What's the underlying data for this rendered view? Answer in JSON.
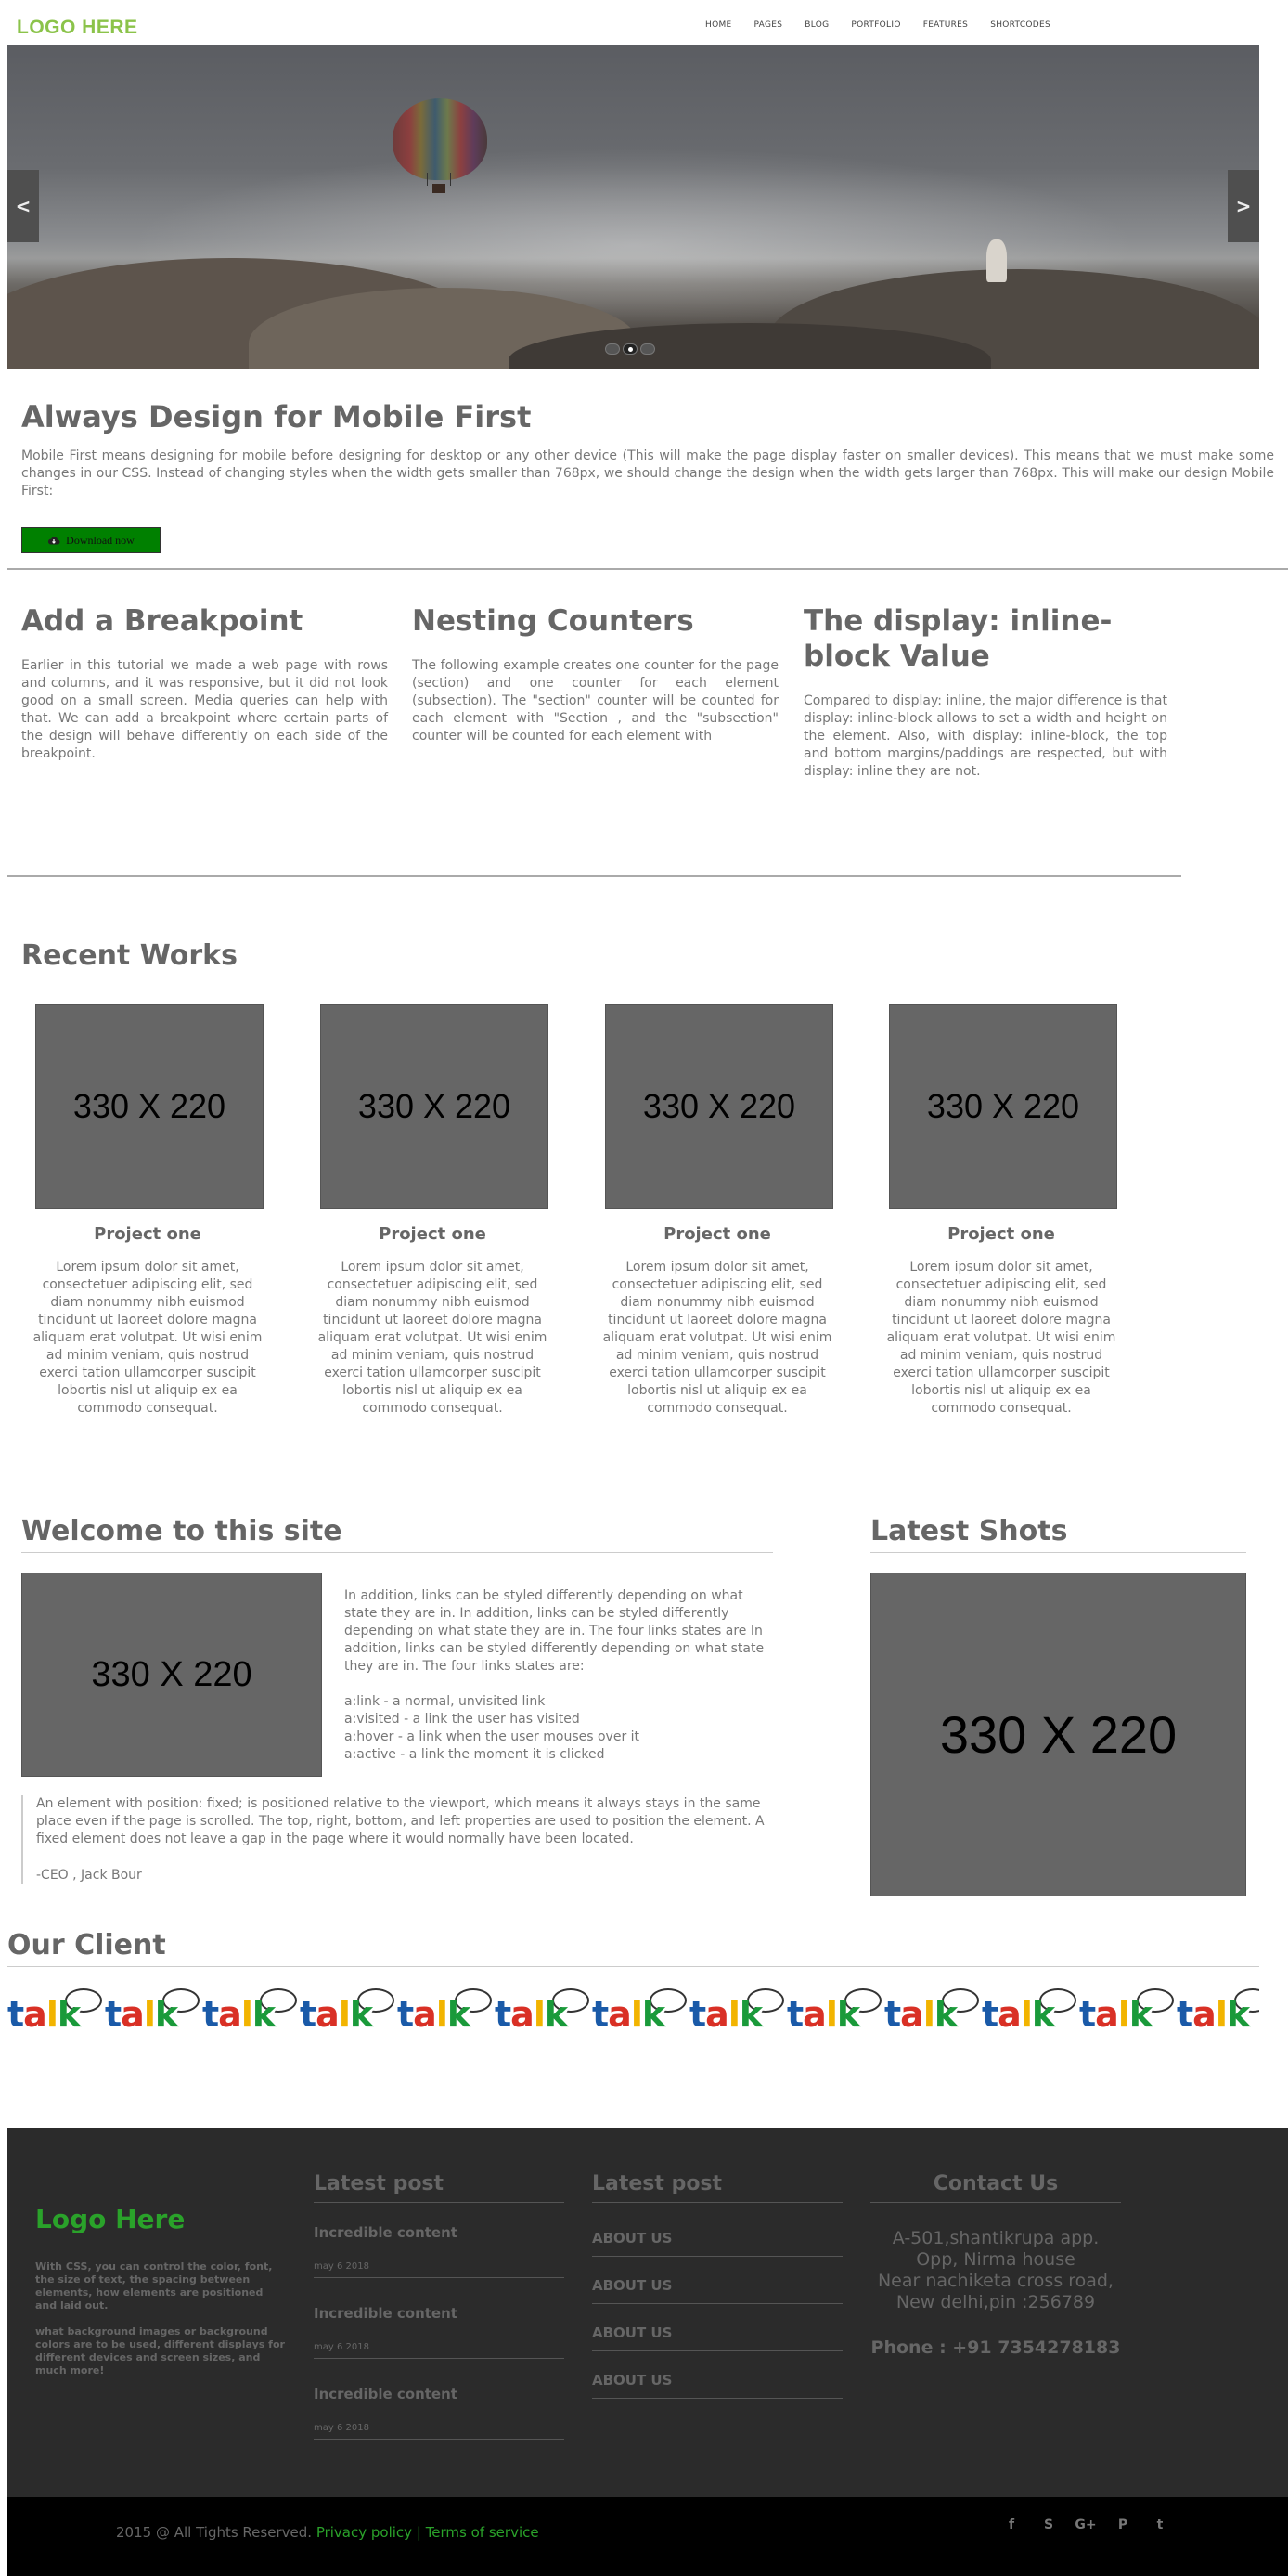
{
  "header": {
    "logo": "LOGO HERE",
    "nav": [
      "HOME",
      "PAGES",
      "BLOG",
      "PORTFOLIO",
      "FEATURES",
      "SHORTCODES"
    ]
  },
  "slider": {
    "prev_label": "<",
    "next_label": ">",
    "slide_count": 3,
    "active_slide": 2
  },
  "intro": {
    "title": "Always Design for Mobile First",
    "text": "Mobile First means designing for mobile before designing for desktop or any other device (This will make the page display faster on smaller devices). This means that we must make some changes in our CSS. Instead of changing styles when the width gets smaller than 768px, we should change the design when the width gets larger than 768px. This will make our design Mobile First:",
    "button_label": "Download now",
    "button_icon": "cloud-download-icon"
  },
  "features": [
    {
      "title": "Add a Breakpoint",
      "text": "Earlier in this tutorial we made a web page with rows and columns, and it was responsive, but it did not look good on a small screen. Media queries can help with that. We can add a breakpoint where certain parts of the design will behave differently on each side of the breakpoint."
    },
    {
      "title": "Nesting Counters",
      "text": "The following example creates one counter for the page (section) and one counter for each element (subsection). The \"section\" counter will be counted for each element with \"Section , and the \"subsection\" counter will be counted for each element with"
    },
    {
      "title": "The display: inline-block Value",
      "text": "Compared to display: inline, the major difference is that display: inline-block allows to set a width and height on the element. Also, with display: inline-block, the top and bottom margins/paddings are respected, but with display: inline they are not."
    }
  ],
  "recent_works": {
    "title": "Recent Works",
    "items": [
      {
        "image_label": "330 X  220",
        "title": "Project one",
        "text": "Lorem ipsum dolor sit amet, consectetuer adipiscing elit, sed diam nonummy nibh euismod tincidunt ut laoreet dolore magna aliquam erat volutpat. Ut wisi enim ad minim veniam, quis nostrud exerci tation ullamcorper suscipit lobortis nisl ut aliquip ex ea commodo consequat."
      },
      {
        "image_label": "330 X  220",
        "title": "Project one",
        "text": "Lorem ipsum dolor sit amet, consectetuer adipiscing elit, sed diam nonummy nibh euismod tincidunt ut laoreet dolore magna aliquam erat volutpat. Ut wisi enim ad minim veniam, quis nostrud exerci tation ullamcorper suscipit lobortis nisl ut aliquip ex ea commodo consequat."
      },
      {
        "image_label": "330 X  220",
        "title": "Project one",
        "text": "Lorem ipsum dolor sit amet, consectetuer adipiscing elit, sed diam nonummy nibh euismod tincidunt ut laoreet dolore magna aliquam erat volutpat. Ut wisi enim ad minim veniam, quis nostrud exerci tation ullamcorper suscipit lobortis nisl ut aliquip ex ea commodo consequat."
      },
      {
        "image_label": "330 X  220",
        "title": "Project one",
        "text": "Lorem ipsum dolor sit amet, consectetuer adipiscing elit, sed diam nonummy nibh euismod tincidunt ut laoreet dolore magna aliquam erat volutpat. Ut wisi enim ad minim veniam, quis nostrud exerci tation ullamcorper suscipit lobortis nisl ut aliquip ex ea commodo consequat."
      }
    ]
  },
  "welcome": {
    "title": "Welcome to this site",
    "image_label": "330 X  220",
    "text": "In addition, links can be styled differently depending on what state they are in. In addition, links can be styled differently depending on what state they are in. The four links states are In addition, links can be styled differently depending on what state they are in. The four links states are:",
    "link_states": [
      "a:link - a normal, unvisited link",
      "a:visited - a link the user has visited",
      "a:hover - a link when the user mouses over it",
      "a:active - a link the moment it is clicked"
    ],
    "quote": "An element with position: fixed; is positioned relative to the viewport, which means it always stays in the same place even if the page is scrolled. The top, right, bottom, and left properties are used to position the element. A fixed element does not leave a gap in the page where it would normally have been located.",
    "quote_author": "-CEO , Jack Bour"
  },
  "latest_shots": {
    "title": "Latest Shots",
    "image_label": "330 X  220"
  },
  "clients": {
    "title": "Our Client",
    "logo_word": "talk",
    "logo_count": 13
  },
  "footer": {
    "logo": "Logo Here",
    "about_1": "With CSS, you can control the color, font, the size of text, the spacing between elements, how elements are positioned and laid out.",
    "about_2": "what background images or background colors are to be used, different displays for different devices and screen sizes, and much more!",
    "posts_title": "Latest post",
    "posts": [
      {
        "title": "Incredible content",
        "date": "may 6 2018"
      },
      {
        "title": "Incredible content",
        "date": "may 6 2018"
      },
      {
        "title": "Incredible content",
        "date": "may 6 2018"
      }
    ],
    "links_title": "Latest post",
    "links": [
      "ABOUT US",
      "ABOUT US",
      "ABOUT US",
      "ABOUT US"
    ],
    "contact_title": "Contact Us",
    "address": [
      "A-501,shantikrupa app.",
      "Opp, Nirma house",
      "Near nachiketa cross road,",
      "New delhi,pin :256789"
    ],
    "phone": "Phone : +91 7354278183"
  },
  "bottom": {
    "copyright": "2015 @ All Tights Reserved.",
    "privacy": "Privacy policy",
    "separator": "|",
    "terms": "Terms of service",
    "social": [
      {
        "icon": "facebook-icon",
        "glyph": "f"
      },
      {
        "icon": "skype-icon",
        "glyph": "S"
      },
      {
        "icon": "google-plus-icon",
        "glyph": "G+"
      },
      {
        "icon": "pinterest-icon",
        "glyph": "P"
      },
      {
        "icon": "twitter-icon",
        "glyph": "t"
      }
    ]
  },
  "colors": {
    "brand_green": "#8bc34a",
    "footer_green": "#2aa22a",
    "button_green": "#008000",
    "placeholder_gray": "#666666",
    "footer_bg": "#2b2b2b",
    "talk_colors": [
      "#1a5aa8",
      "#d93025",
      "#f2b400",
      "#1a9a3a"
    ]
  }
}
